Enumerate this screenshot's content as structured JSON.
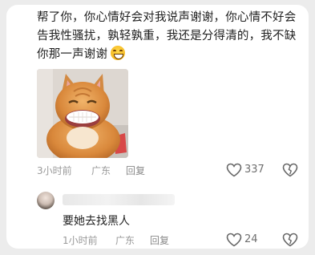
{
  "comment": {
    "text": "帮了你，你心情好会对我说声谢谢，你心情不好会告我性骚扰，孰轻孰重，我还是分得清的，我不缺你那一声谢谢",
    "emoji": "grinning-face-emoji",
    "image_alt": "cat-with-human-teeth-photo",
    "time": "3小时前",
    "location": "广东",
    "reply_label": "回复",
    "like_count": "337"
  },
  "reply": {
    "text": "要她去找黑人",
    "time": "1小时前",
    "location": "广东",
    "reply_label": "回复",
    "like_count": "24"
  },
  "colors": {
    "background": "#ececec",
    "card": "#ffffff",
    "text_primary": "#1f1f1f",
    "text_secondary": "#9a9a9a"
  }
}
